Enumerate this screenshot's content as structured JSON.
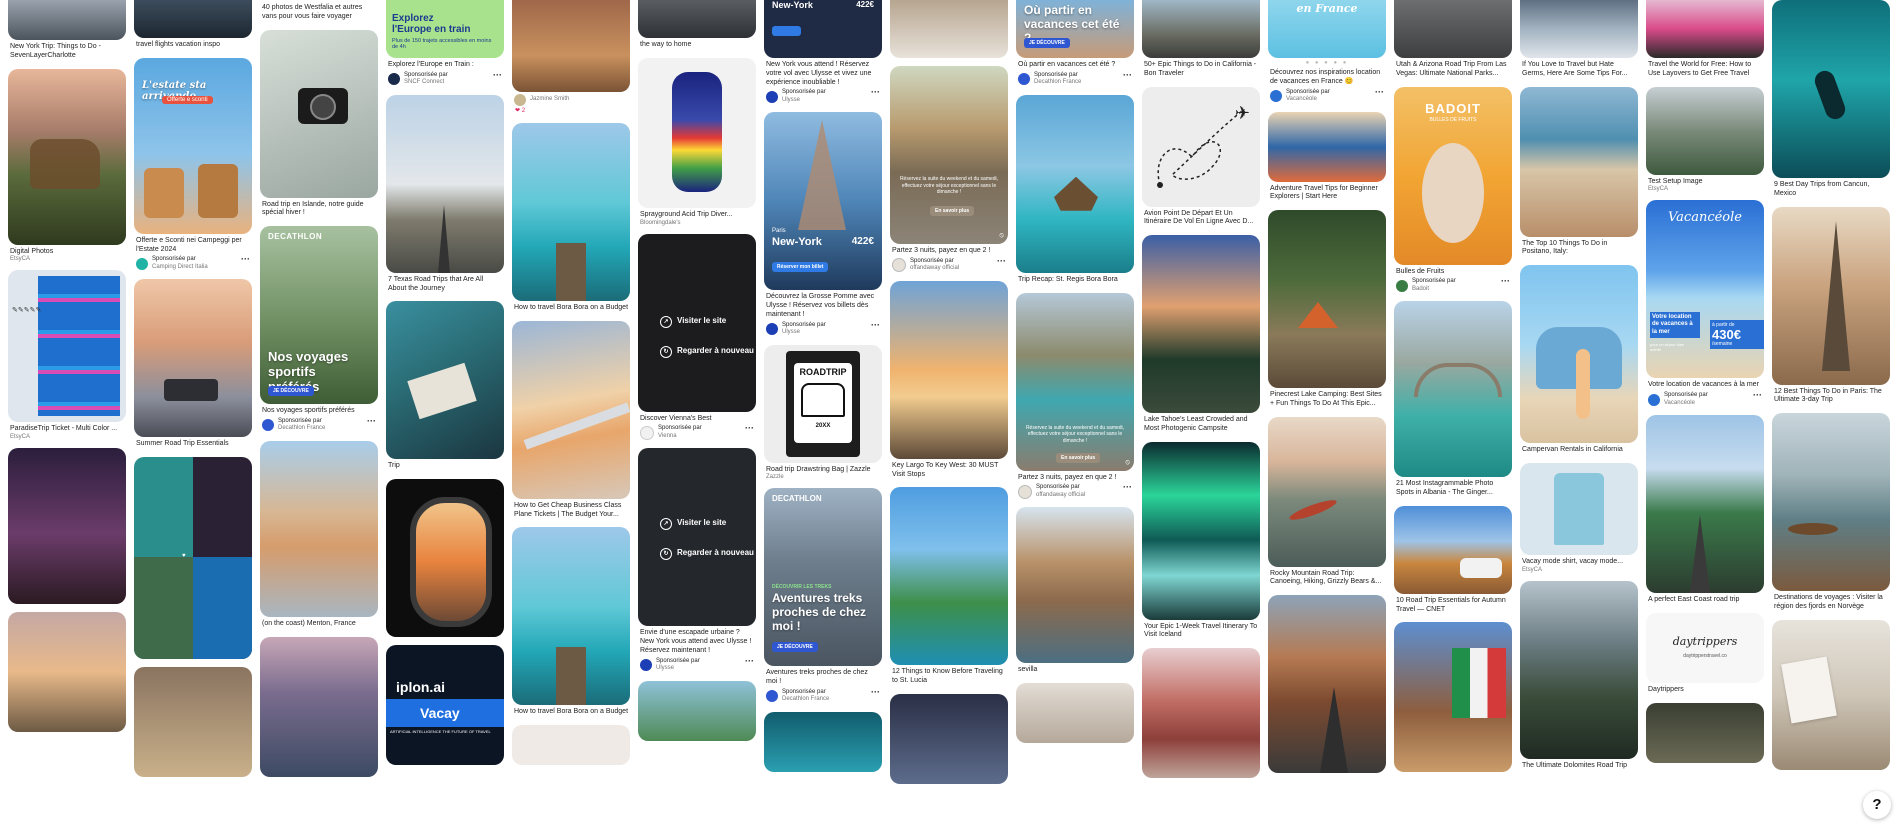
{
  "pins": {
    "ny_trip": {
      "title": "New York Trip: Things to Do - SevenLayerCharlotte"
    },
    "digital_photos": {
      "title": "Digital Photos",
      "sub": "EtsyCA"
    },
    "paradise_ticket": {
      "title": "ParadiseTrip Ticket - Multi Color ...",
      "sub": "EtsyCA"
    },
    "travel_flights": {
      "title": "travel flights vacation inspo"
    },
    "camping_ad": {
      "title": "Offerte e Sconti nei Campeggi per l'Estate 2024",
      "overlay": "L'estate sta arrivando",
      "overlay2": "Offerte e sconti",
      "sponsored": "Sponsorisée par",
      "advertiser": "Camping Direct Italia"
    },
    "summer_road": {
      "title": "Summer Road Trip Essentials"
    },
    "westfalia": {
      "title": "40 photos de Westfalia et autres vans pour vous faire voyager"
    },
    "iceland": {
      "title": "Road trip en Islande, notre guide spécial hiver !"
    },
    "decathlon_sport": {
      "title": "Nos voyages sportifs préférés",
      "overlay": "Nos voyages sportifs préférés",
      "brand": "DECATHLON",
      "cta": "JE DÉCOUVRE",
      "sponsored": "Sponsorisée par",
      "advertiser": "Decathlon France"
    },
    "menton": {
      "title": "(on the coast) Menton, France"
    },
    "sncf": {
      "title": "Explorez l'Europe en Train :",
      "overlay": "Explorez l'Europe en train",
      "overlay2": "Plus de 150 trajets accessibles en moins de 4h",
      "sponsored": "Sponsorisée par",
      "advertiser": "SNCF Connect"
    },
    "texas": {
      "title": "7 Texas Road Trips that Are All About the Journey"
    },
    "trip": {
      "title": "Trip"
    },
    "iplon": {
      "overlay": "iplon.ai",
      "overlay2": "Vacay",
      "overlay3": "ARTIFICIAL INTELLIGENCE THE FUTURE OF TRAVEL"
    },
    "jazmine": {
      "user": "Jazmine Smith",
      "likes": "2"
    },
    "bora1": {
      "title": "How to travel Bora Bora on a Budget"
    },
    "business_class": {
      "title": "How to Get Cheap Business Class Plane Tickets | The Budget Your..."
    },
    "bora2": {
      "title": "How to travel Bora Bora on a Budget"
    },
    "way_home": {
      "title": "the way to home"
    },
    "backpack": {
      "title": "Sprayground Acid Trip Diver...",
      "sub": "Bloomingdale's"
    },
    "vienna": {
      "title": "Discover Vienna's Best",
      "visit": "Visiter le site",
      "watch": "Regarder à nouveau",
      "sponsored": "Sponsorisée par",
      "advertiser": "Vienna"
    },
    "ulysse_video": {
      "title": "Envie d'une escapade urbaine ? New York vous attend avec Ulysse ! Réservez maintenant !",
      "visit": "Visiter le site",
      "watch": "Regarder à nouveau",
      "sponsored": "Sponsorisée par",
      "advertiser": "Ulysse"
    },
    "ulysse_top": {
      "title": "New York vous attend ! Réservez votre vol avec Ulysse et vivez une expérience inoubliable !",
      "city": "New-York",
      "price": "422€",
      "sponsored": "Sponsorisée par",
      "advertiser": "Ulysse"
    },
    "ulysse_flatiron": {
      "title": "Découvrez la Grosse Pomme avec Ulysse ! Réservez vos billets dès maintenant !",
      "from": "Paris",
      "city": "New-York",
      "price": "422€",
      "cta": "Réserver mon billet",
      "sponsored": "Sponsorisée par",
      "advertiser": "Ulysse"
    },
    "roadtrip_bag": {
      "title": "Road trip Drawstring Bag | Zazzle",
      "sub": "Zazzle",
      "bag_text": "ROADTRIP",
      "bag_year": "20XX"
    },
    "decathlon_treks": {
      "title": "Aventures treks proches de chez moi !",
      "brand": "DECATHLON",
      "overlay": "Aventures treks proches de chez moi !",
      "overlay_small": "DÉCOUVRIR LES TREKS",
      "cta": "JE DÉCOUVRE",
      "sponsored": "Sponsorisée par",
      "advertiser": "Decathlon France"
    },
    "offandaway1": {
      "title": "Partez 3 nuits, payez en que 2 !",
      "overlay": "Réservez la suite du weekend et du samedi, effectuez votre séjour exceptionnel sans le dimanche !",
      "cta": "En savoir plus",
      "sponsored": "Sponsorisée par",
      "advertiser": "offandaway official"
    },
    "key_largo": {
      "title": "Key Largo To Key West: 30 MUST Visit Stops"
    },
    "st_lucia": {
      "title": "12 Things to Know Before Traveling to St. Lucia"
    },
    "decathlon_vacances": {
      "title": "Où partir en vacances cet été ?",
      "overlay": "Où partir en vacances cet été ?",
      "cta": "JE DÉCOUVRE",
      "sponsored": "Sponsorisée par",
      "advertiser": "Decathlon France"
    },
    "st_regis": {
      "title": "Trip Recap: St. Regis Bora Bora"
    },
    "offandaway2": {
      "title": "Partez 3 nuits, payez en que 2 !",
      "overlay": "Réservez la suite du weekend et du samedi, effectuez votre séjour exceptionnel sans le dimanche !",
      "cta": "En savoir plus",
      "sponsored": "Sponsorisée par",
      "advertiser": "offandaway official"
    },
    "sevilla": {
      "title": "sevilla"
    },
    "california": {
      "title": "50+ Epic Things to Do in California - Bon Traveler"
    },
    "avion": {
      "title": "Avion Point De Départ Et Un Itinéraire De Vol En Ligne Avec D..."
    },
    "lake_tahoe": {
      "title": "Lake Tahoe's Least Crowded and Most Photogenic Campsite"
    },
    "iceland_week": {
      "title": "Your Epic 1-Week Travel Itinerary To Visit Iceland"
    },
    "vacanceole1": {
      "title": "Découvrez nos inspirations location de vacances en France 😊",
      "overlay": "en France",
      "sponsored": "Sponsorisée par",
      "advertiser": "Vacancéole"
    },
    "adventure_tips": {
      "title": "Adventure Travel Tips for Beginner Explorers | Start Here"
    },
    "pinecrest": {
      "title": "Pinecrest Lake Camping: Best Sites + Fun Things To Do At This Epic..."
    },
    "rocky": {
      "title": "Rocky Mountain Road Trip: Canoeing, Hiking, Grizzly Bears &..."
    },
    "utah": {
      "title": "Utah & Arizona Road Trip From Las Vegas: Ultimate National Parks..."
    },
    "badoit": {
      "title": "Bulles de Fruits",
      "brand": "BADOIT",
      "tagline": "BULLES DE FRUITS",
      "sponsored": "Sponsorisée par",
      "advertiser": "Badoit"
    },
    "albania": {
      "title": "21 Most Instagrammable Photo Spots in Albania - The Ginger..."
    },
    "autumn": {
      "title": "10 Road Trip Essentials for Autumn Travel — CNET"
    },
    "germs": {
      "title": "If You Love to Travel but Hate Germs, Here Are Some Tips For..."
    },
    "positano": {
      "title": "The Top 10 Things To Do in Positano, Italy:"
    },
    "campervan": {
      "title": "Campervan Rentals in California"
    },
    "vacay_shirt": {
      "title": "Vacay mode shirt, vacay mode...",
      "sub": "EtsyCA"
    },
    "dolomites": {
      "title": "The Ultimate Dolomites Road Trip"
    },
    "layovers": {
      "title": "Travel the World for Free: How to Use Layovers to Get Free Travel"
    },
    "test_setup": {
      "title": "Test Setup Image",
      "sub": "EtsyCA"
    },
    "vacanceole2": {
      "title": "Votre location de vacances à la mer",
      "brand": "Vacancéole",
      "overlay": "Votre location de vacances à la mer",
      "overlay_small": "pour un séjour bien mérité",
      "price_prefix": "à partir de",
      "price": "430€",
      "price_suffix": "/semaine",
      "sponsored": "Sponsorisée par",
      "advertiser": "Vacancéole"
    },
    "east_coast": {
      "title": "A perfect East Coast road trip"
    },
    "daytrippers": {
      "title": "Daytrippers",
      "logo": "daytrippers",
      "logo_sub": "daytripperstravel.co"
    },
    "cancun": {
      "title": "9 Best Day Trips from Cancun, Mexico"
    },
    "paris": {
      "title": "12 Best Things To Do in Paris: The Ultimate 3-day Trip"
    },
    "norvege": {
      "title": "Destinations de voyages : Visiter la région des fjords en Norvège"
    }
  },
  "colors": {
    "accent": "#2e57d1",
    "text": "#111111",
    "muted": "#767676",
    "badoit": "#f2a533",
    "vacanceole": "#2a6fd4"
  },
  "icons": [
    "more-options-icon",
    "play-icon",
    "replay-icon",
    "heart-icon",
    "help-icon",
    "plane-icon",
    "hide-icon"
  ],
  "help": {
    "label": "?"
  }
}
